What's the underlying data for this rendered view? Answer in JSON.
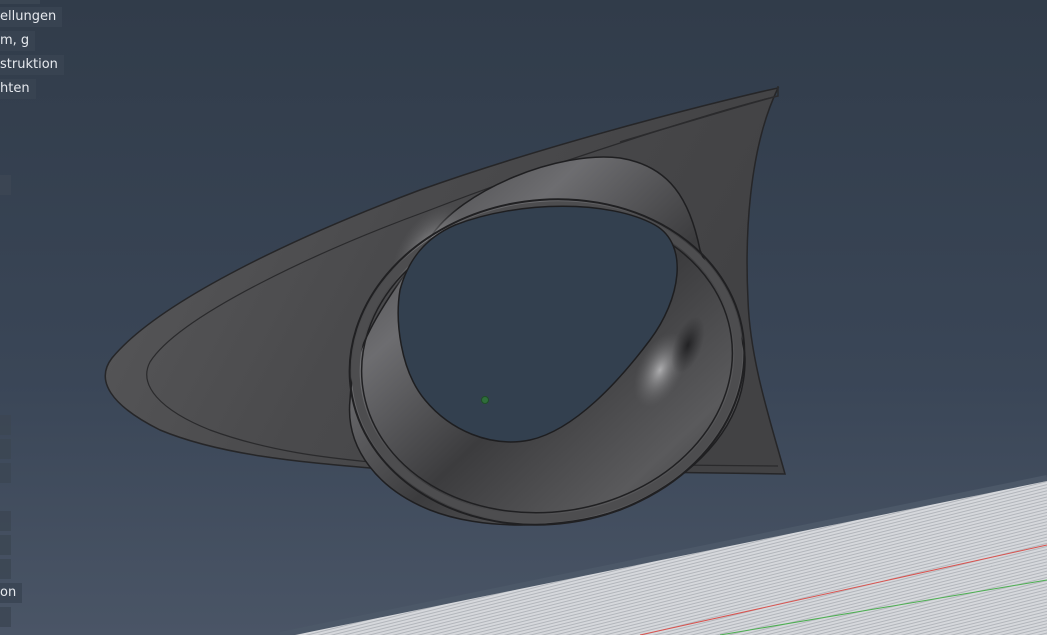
{
  "viewport": {
    "background": "#34404f",
    "model_color": "#4e4e50"
  },
  "side_panel": {
    "items": [
      {
        "label": "ellungen"
      },
      {
        "label": "m, g"
      },
      {
        "label": "struktion"
      },
      {
        "label": "hten"
      }
    ],
    "bottom_item": {
      "label": "on"
    }
  }
}
